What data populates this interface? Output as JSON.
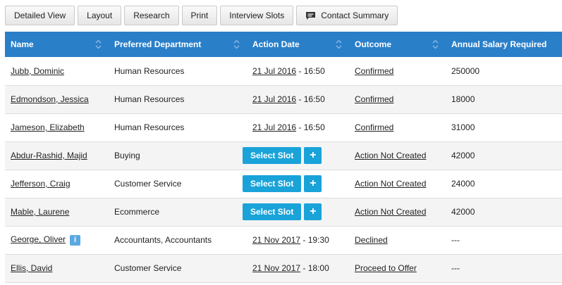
{
  "toolbar": {
    "buttons": [
      "Detailed View",
      "Layout",
      "Research",
      "Print",
      "Interview Slots",
      "Contact Summary"
    ]
  },
  "table": {
    "headers": [
      "Name",
      "Preferred Department",
      "Action Date",
      "Outcome",
      "Annual Salary Required"
    ],
    "slot_label": "Select Slot",
    "plus_label": "+",
    "info_label": "i",
    "rows": [
      {
        "name": "Jubb, Dominic",
        "dept": "Human Resources",
        "date": "21 Jul 2016",
        "time": "16:50",
        "outcome": "Confirmed",
        "salary": "250000"
      },
      {
        "name": "Edmondson, Jessica",
        "dept": "Human Resources",
        "date": "21 Jul 2016",
        "time": "16:50",
        "outcome": "Confirmed",
        "salary": "18000"
      },
      {
        "name": "Jameson, Elizabeth",
        "dept": "Human Resources",
        "date": "21 Jul 2016",
        "time": "16:50",
        "outcome": "Confirmed",
        "salary": "31000"
      },
      {
        "name": "Abdur-Rashid, Majid",
        "dept": "Buying",
        "date": "",
        "time": "",
        "outcome": "Action Not Created",
        "salary": "42000"
      },
      {
        "name": "Jefferson, Craig",
        "dept": "Customer Service",
        "date": "",
        "time": "",
        "outcome": "Action Not Created",
        "salary": "24000"
      },
      {
        "name": "Mable, Laurene",
        "dept": "Ecommerce",
        "date": "",
        "time": "",
        "outcome": "Action Not Created",
        "salary": "42000"
      },
      {
        "name": "George, Oliver",
        "dept": "Accountants, Accountants",
        "date": "21 Nov 2017",
        "time": "19:30",
        "outcome": "Declined",
        "salary": "---"
      },
      {
        "name": "Ellis, David",
        "dept": "Customer Service",
        "date": "21 Nov 2017",
        "time": "18:00",
        "outcome": "Proceed to Offer",
        "salary": "---"
      }
    ]
  },
  "colors": {
    "header_bg": "#2a7fc9",
    "slot_button": "#1aa3d9",
    "info_badge": "#5ba9e0"
  }
}
